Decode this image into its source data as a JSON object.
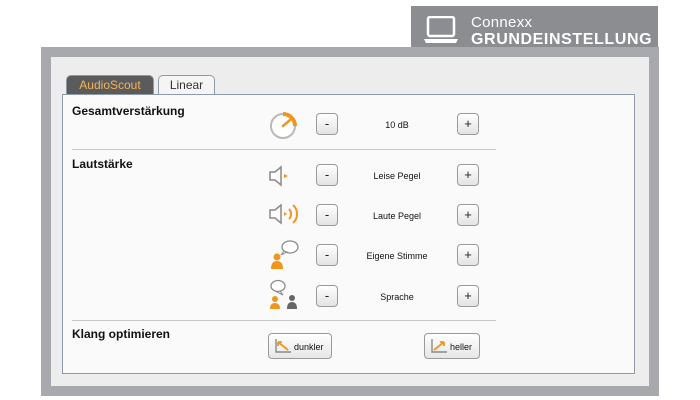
{
  "badge": {
    "brand": "Connexx",
    "subtitle": "GRUNDEINSTELLUNG",
    "icon": "laptop-icon"
  },
  "tabs": [
    {
      "label": "AudioScout",
      "active": true
    },
    {
      "label": "Linear",
      "active": false
    }
  ],
  "overall_gain": {
    "title": "Gesamtverstärkung",
    "value": "10 dB",
    "icon": "gain-dial-icon",
    "minus": "-",
    "plus": "+"
  },
  "volume": {
    "title": "Lautstärke",
    "rows": [
      {
        "label": "Leise Pegel",
        "icon": "quiet-speaker-icon",
        "minus": "-",
        "plus": "+"
      },
      {
        "label": "Laute Pegel",
        "icon": "loud-speaker-icon",
        "minus": "-",
        "plus": "+"
      },
      {
        "label": "Eigene Stimme",
        "icon": "own-voice-icon",
        "minus": "-",
        "plus": "+"
      },
      {
        "label": "Sprache",
        "icon": "speech-icon",
        "minus": "-",
        "plus": "+"
      }
    ]
  },
  "sound": {
    "title": "Klang optimieren",
    "darker": "dunkler",
    "brighter": "heller"
  },
  "colors": {
    "accent": "#f0961e",
    "frame": "#a7a9ac",
    "badge": "#8b8d91"
  }
}
